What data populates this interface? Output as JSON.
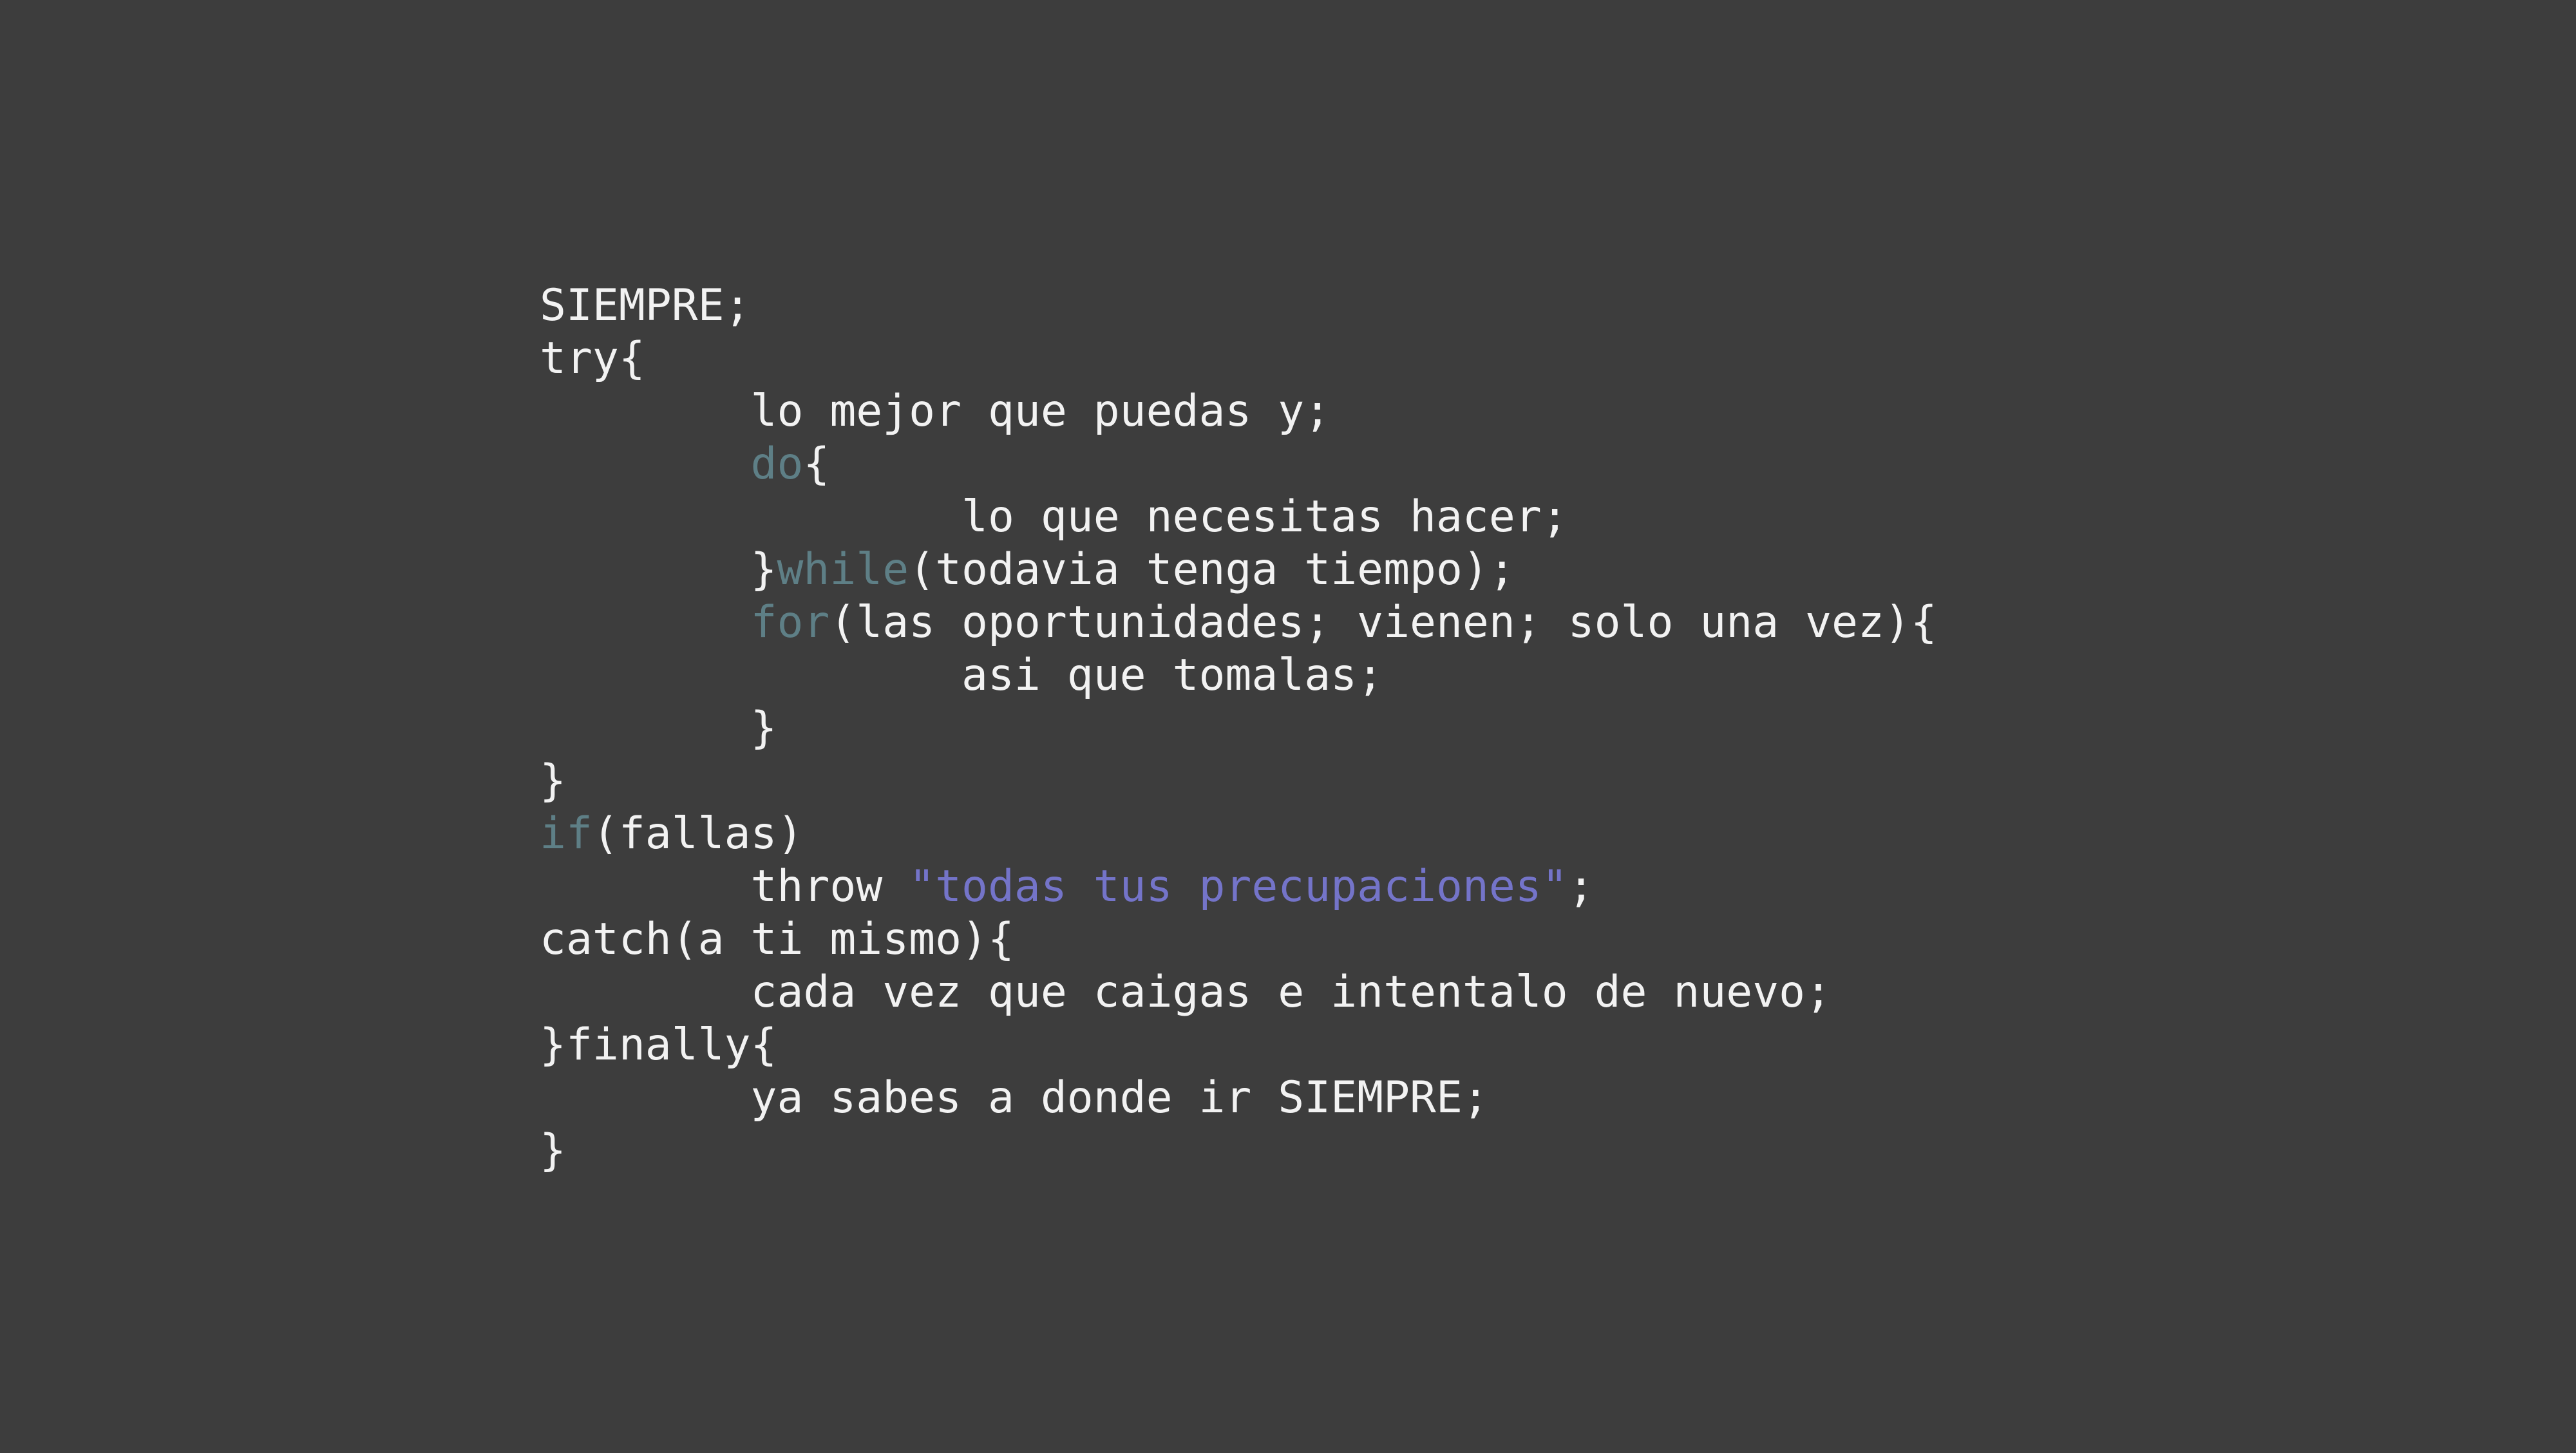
{
  "colors": {
    "background": "#3d3d3d",
    "text": "#f2f2f2",
    "keyword": "#5e7f86",
    "string": "#7474c9"
  },
  "code": {
    "lines": [
      [
        {
          "text": "SIEMPRE;",
          "kind": "plain"
        }
      ],
      [
        {
          "text": "try{",
          "kind": "plain"
        }
      ],
      [
        {
          "text": "        lo mejor que puedas y;",
          "kind": "plain"
        }
      ],
      [
        {
          "text": "        ",
          "kind": "plain"
        },
        {
          "text": "do",
          "kind": "kw"
        },
        {
          "text": "{",
          "kind": "plain"
        }
      ],
      [
        {
          "text": "                lo que necesitas hacer;",
          "kind": "plain"
        }
      ],
      [
        {
          "text": "        }",
          "kind": "plain"
        },
        {
          "text": "while",
          "kind": "kw"
        },
        {
          "text": "(todavia tenga tiempo);",
          "kind": "plain"
        }
      ],
      [
        {
          "text": "        ",
          "kind": "plain"
        },
        {
          "text": "for",
          "kind": "kw"
        },
        {
          "text": "(las oportunidades; vienen; solo una vez){",
          "kind": "plain"
        }
      ],
      [
        {
          "text": "                asi que tomalas;",
          "kind": "plain"
        }
      ],
      [
        {
          "text": "        }",
          "kind": "plain"
        }
      ],
      [
        {
          "text": "}",
          "kind": "plain"
        }
      ],
      [
        {
          "text": "if",
          "kind": "kw"
        },
        {
          "text": "(fallas)",
          "kind": "plain"
        }
      ],
      [
        {
          "text": "        throw ",
          "kind": "plain"
        },
        {
          "text": "\"todas tus precupaciones\"",
          "kind": "str"
        },
        {
          "text": ";",
          "kind": "plain"
        }
      ],
      [
        {
          "text": "catch(a ti mismo){",
          "kind": "plain"
        }
      ],
      [
        {
          "text": "        cada vez que caigas e intentalo de nuevo;",
          "kind": "plain"
        }
      ],
      [
        {
          "text": "}finally{",
          "kind": "plain"
        }
      ],
      [
        {
          "text": "        ya sabes a donde ir SIEMPRE;",
          "kind": "plain"
        }
      ],
      [
        {
          "text": "}",
          "kind": "plain"
        }
      ]
    ]
  }
}
